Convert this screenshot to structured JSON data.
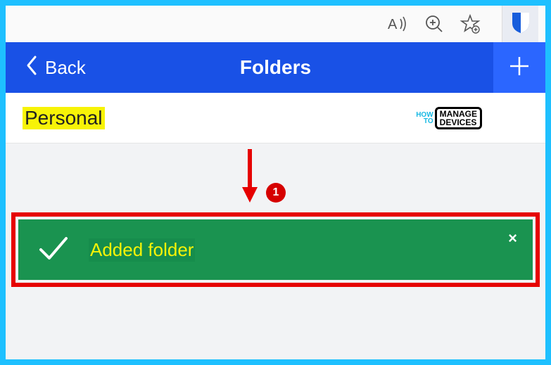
{
  "browser_toolbar": {
    "read_aloud_icon": "read-aloud",
    "zoom_icon": "zoom",
    "favorite_icon": "favorite",
    "extension_icon": "bitwarden"
  },
  "header": {
    "back_label": "Back",
    "title": "Folders",
    "add_label": "Add"
  },
  "folders": [
    {
      "name": "Personal"
    }
  ],
  "watermark": {
    "line1": "HOW",
    "line2": "TO",
    "box_line1": "MANAGE",
    "box_line2": "DEVICES"
  },
  "annotation": {
    "callout_number": "1"
  },
  "toast": {
    "message": "Added folder",
    "close": "×"
  }
}
